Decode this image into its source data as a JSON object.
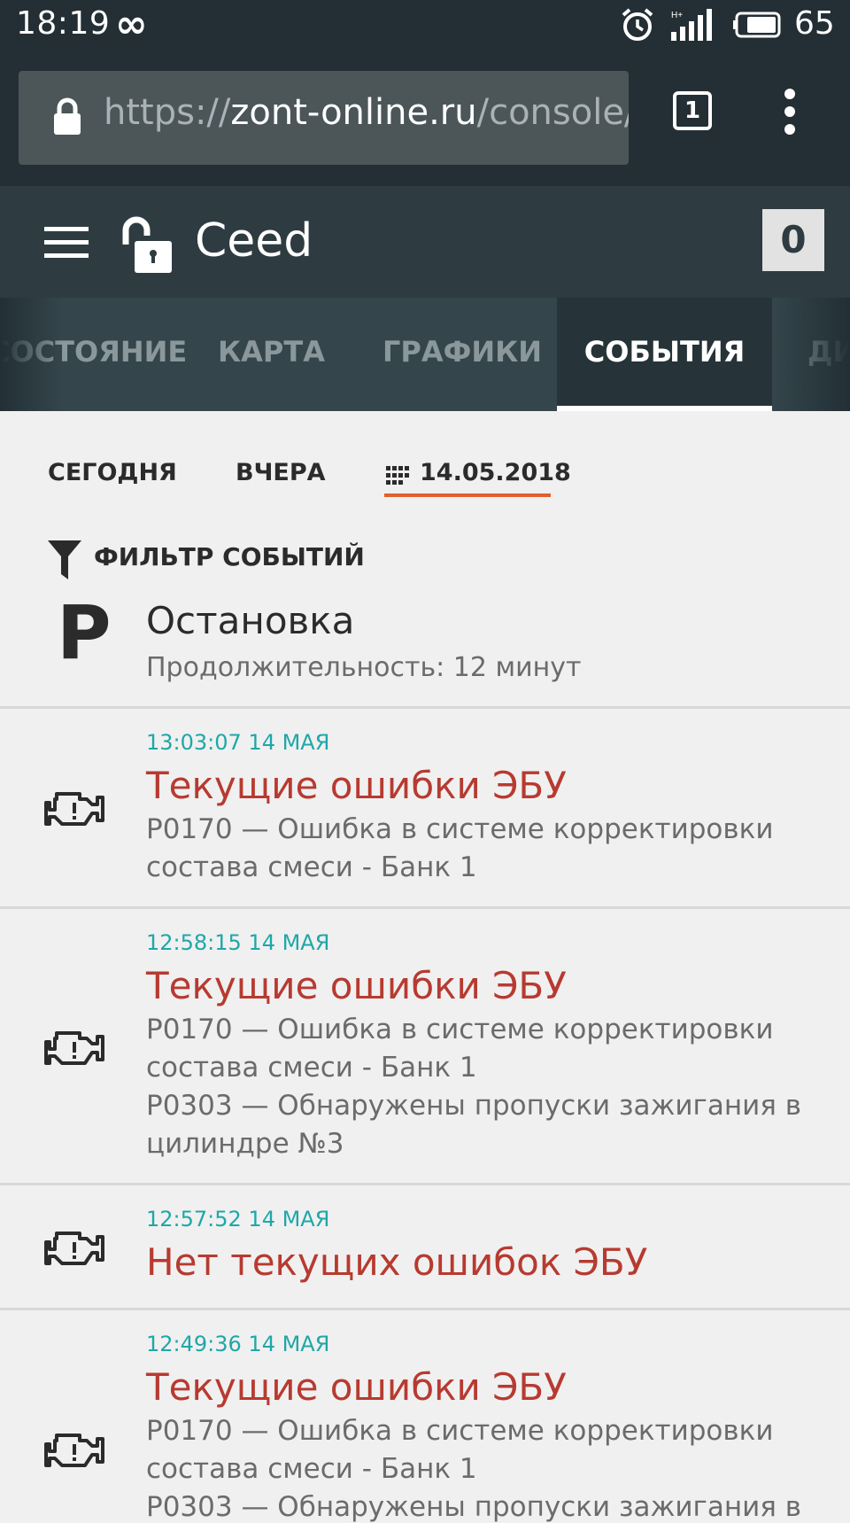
{
  "status_bar": {
    "time": "18:19",
    "infinity": "∞",
    "battery": "65"
  },
  "browser": {
    "url_scheme": "https://",
    "url_host": "zont-online.ru",
    "url_path": "/console/",
    "tab_count": "1"
  },
  "app": {
    "title": "Ceed",
    "counter": "0"
  },
  "tabs": [
    {
      "label": "СОСТОЯНИЕ",
      "active": false
    },
    {
      "label": "КАРТА",
      "active": false
    },
    {
      "label": "ГРАФИКИ",
      "active": false
    },
    {
      "label": "СОБЫТИЯ",
      "active": true
    },
    {
      "label": "ДИ",
      "active": false
    }
  ],
  "date_filter": {
    "today": "СЕГОДНЯ",
    "yesterday": "ВЧЕРА",
    "selected_date": "14.05.2018"
  },
  "event_filter_label": "ФИЛЬТР СОБЫТИЙ",
  "stop_event": {
    "icon": "P",
    "title": "Остановка",
    "detail": "Продолжительность: 12 минут"
  },
  "events": [
    {
      "time": "13:03:07 14 МАЯ",
      "title": "Текущие ошибки ЭБУ",
      "lines": [
        "P0170 — Ошибка в системе корректировки",
        "состава смеси - Банк 1"
      ]
    },
    {
      "time": "12:58:15 14 МАЯ",
      "title": "Текущие ошибки ЭБУ",
      "lines": [
        "P0170 — Ошибка в системе корректировки",
        "состава смеси - Банк 1",
        "P0303 — Обнаружены пропуски зажигания в",
        "цилиндре №3"
      ]
    },
    {
      "time": "12:57:52 14 МАЯ",
      "title": "Нет текущих ошибок ЭБУ",
      "lines": []
    },
    {
      "time": "12:49:36 14 МАЯ",
      "title": "Текущие ошибки ЭБУ",
      "lines": [
        "P0170 — Ошибка в системе корректировки",
        "состава смеси - Банк 1",
        "P0303 — Обнаружены пропуски зажигания в"
      ]
    }
  ],
  "colors": {
    "accent_underline": "#e0612e",
    "event_time": "#1fa7a8",
    "event_title": "#b73a30"
  }
}
